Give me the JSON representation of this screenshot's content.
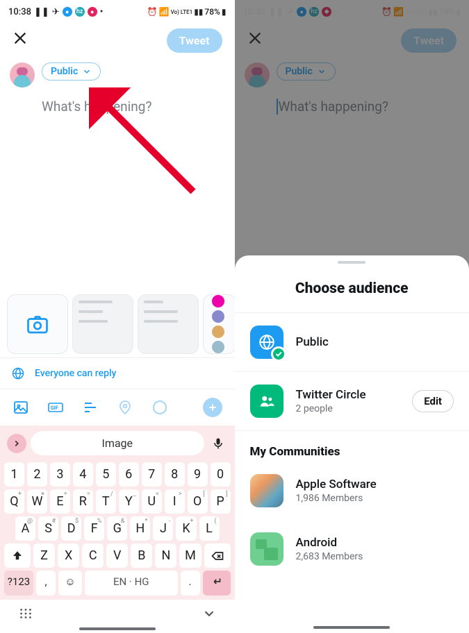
{
  "status": {
    "time": "10:38",
    "battery": "78%",
    "net": "LTE1",
    "vo": "Vo)"
  },
  "compose": {
    "close": "✕",
    "tweet_btn": "Tweet",
    "audience_label": "Public",
    "placeholder": "What's happening?"
  },
  "reply": {
    "text": "Everyone can reply"
  },
  "keyboard": {
    "suggestion": "Image",
    "row1": [
      "1",
      "2",
      "3",
      "4",
      "5",
      "6",
      "7",
      "8",
      "9",
      "0"
    ],
    "row2": [
      "Q",
      "W",
      "E",
      "R",
      "T",
      "Y",
      "U",
      "I",
      "O",
      "P"
    ],
    "row2sup": [
      "+",
      "×",
      "÷",
      "=",
      "/",
      "_",
      "<",
      ">",
      "[",
      "]"
    ],
    "row3": [
      "A",
      "S",
      "D",
      "F",
      "G",
      "H",
      "J",
      "K",
      "L"
    ],
    "row3sup": [
      "@",
      "#",
      "$",
      "%",
      "&",
      "*",
      "-",
      "+",
      "("
    ],
    "row4": [
      "Z",
      "X",
      "C",
      "V",
      "B",
      "N",
      "M"
    ],
    "sym": "?123",
    "space": "EN · HG"
  },
  "sheet": {
    "title": "Choose audience",
    "public": "Public",
    "circle": "Twitter Circle",
    "circle_sub": "2 people",
    "edit": "Edit",
    "communities_header": "My Communities",
    "comm1": "Apple Software",
    "comm1_sub": "1,986 Members",
    "comm2": "Android",
    "comm2_sub": "2,683 Members"
  }
}
